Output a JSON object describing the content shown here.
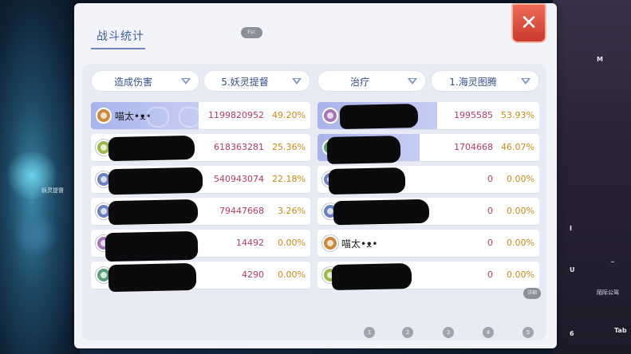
{
  "panel": {
    "title": "战斗统计",
    "small_pill": "Esc",
    "close_label": "✕",
    "mini_button": "详细"
  },
  "left": {
    "type_dropdown": "造成伤害",
    "target_dropdown": "5.妖灵提督",
    "rows": [
      {
        "name": "喵太•ᴥ•",
        "value": "1199820952",
        "percent": "49.20%",
        "avatar_color": "#c98a3a",
        "bar": 0.492
      },
      {
        "name": "",
        "value": "618363281",
        "percent": "25.36%",
        "avatar_color": "#9fb74a",
        "bar": 0
      },
      {
        "name": "",
        "value": "540943074",
        "percent": "22.18%",
        "avatar_color": "#6e7fbf",
        "bar": 0
      },
      {
        "name": "",
        "value": "79447668",
        "percent": "3.26%",
        "avatar_color": "#6e7fbf",
        "bar": 0
      },
      {
        "name": "",
        "value": "14492",
        "percent": "0.00%",
        "avatar_color": "#a476b9",
        "bar": 0
      },
      {
        "name": "",
        "value": "4290",
        "percent": "0.00%",
        "avatar_color": "#5a9f76",
        "bar": 0
      }
    ]
  },
  "right": {
    "type_dropdown": "治疗",
    "target_dropdown": "1.海灵图腾",
    "rows": [
      {
        "name": "",
        "value": "1995585",
        "percent": "53.93%",
        "avatar_color": "#a476b9",
        "bar": 0.5393
      },
      {
        "name": "",
        "value": "1704668",
        "percent": "46.07%",
        "avatar_color": "#5a9f76",
        "bar": 0.4607
      },
      {
        "name": "",
        "value": "0",
        "percent": "0.00%",
        "avatar_color": "#6e7fbf",
        "bar": 0
      },
      {
        "name": "",
        "value": "0",
        "percent": "0.00%",
        "avatar_color": "#6e7fbf",
        "bar": 0
      },
      {
        "name": "喵太•ᴥ•",
        "value": "0",
        "percent": "0.00%",
        "avatar_color": "#c98a3a",
        "bar": 0
      },
      {
        "name": "",
        "value": "0",
        "percent": "0.00%",
        "avatar_color": "#9fb74a",
        "bar": 0
      }
    ]
  },
  "pager": [
    "1",
    "2",
    "3",
    "4",
    "5"
  ],
  "side_keys": {
    "m": "M",
    "i": "I",
    "u": "U",
    "num6": "6",
    "tab": "Tab",
    "dash": "_",
    "left_tag": "妖灵提督",
    "right_tag": "陌际公驾"
  }
}
